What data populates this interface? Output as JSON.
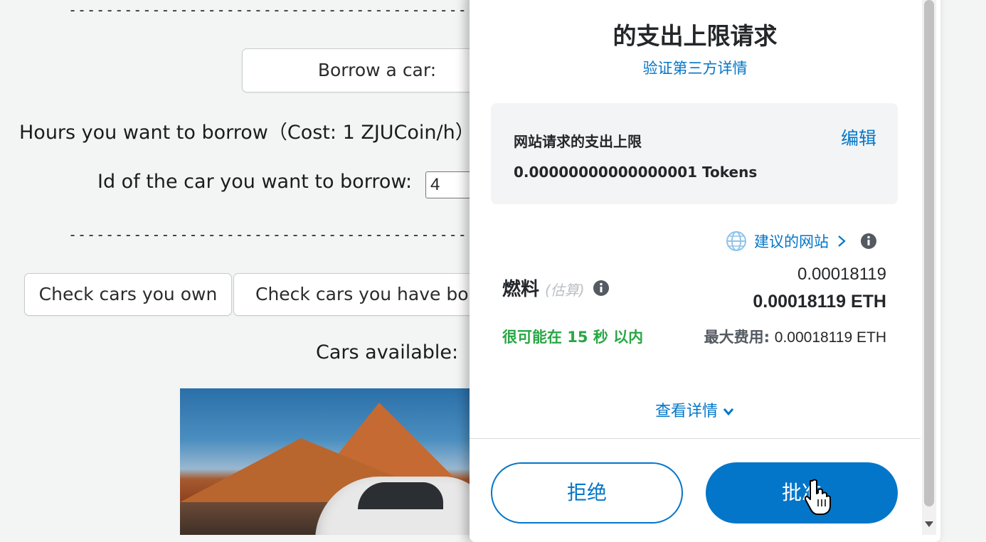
{
  "background_page": {
    "separator": "----------------------------------------------------------------------------",
    "borrow_button": "Borrow a car:",
    "hours_label": "Hours you want to borrow（Cost: 1 ZJUCoin/h）",
    "car_id_label": "Id of the car you want to borrow:",
    "car_id_value": "4",
    "check_own_button": "Check cars you own",
    "check_borrowed_button": "Check cars you have borrowed",
    "cars_available_label": "Cars available:"
  },
  "wallet": {
    "title": "的支出上限请求",
    "verify_link": "验证第三方详情",
    "spending_limit": {
      "label": "网站请求的支出上限",
      "edit": "编辑",
      "value": "0.00000000000000001 Tokens"
    },
    "suggested_site": "建议的网站",
    "gas": {
      "label": "燃料",
      "estimate_tag": "(估算)",
      "fiat_value": "0.00018119",
      "eth_value": "0.00018119 ETH",
      "timing": "很可能在 15 秒 以内",
      "max_fee_label": "最大费用:",
      "max_fee_value": "0.00018119 ETH"
    },
    "view_details": "查看详情",
    "reject_button": "拒绝",
    "approve_button": "批准"
  },
  "colors": {
    "accent": "#0376c9",
    "success": "#28a745",
    "card_bg": "#f2f4f6",
    "page_bg": "#f3f4f4"
  },
  "icons": [
    "globe-icon",
    "chevron-right-icon",
    "info-icon",
    "chevron-down-icon",
    "hand-cursor-icon"
  ]
}
